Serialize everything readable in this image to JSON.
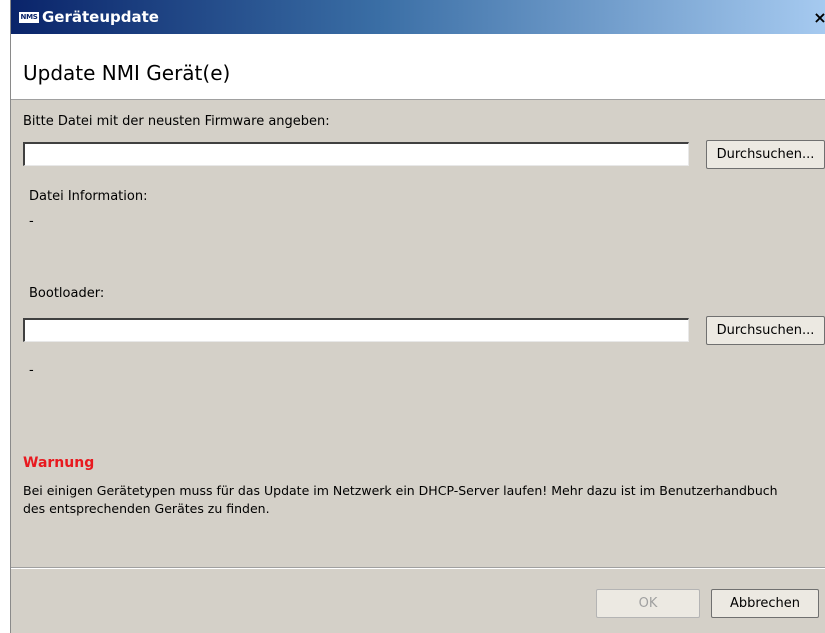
{
  "window": {
    "logo_text": "NMS",
    "title": "Geräteupdate",
    "close_glyph": "×"
  },
  "header": {
    "title": "Update NMI Gerät(e)"
  },
  "firmware": {
    "label": "Bitte Datei mit der neusten Firmware angeben:",
    "value": "",
    "browse_label": "Durchsuchen...",
    "info_label": "Datei Information:",
    "info_value": "-"
  },
  "bootloader": {
    "label": "Bootloader:",
    "value": "",
    "browse_label": "Durchsuchen...",
    "info_value": "-"
  },
  "warning": {
    "title": "Warnung",
    "text": "Bei einigen Gerätetypen muss für das Update im Netzwerk ein DHCP-Server laufen! Mehr dazu ist im Benutzerhandbuch des entsprechenden Gerätes zu finden.",
    "color": "#e8191f"
  },
  "footer": {
    "ok_label": "OK",
    "ok_enabled": false,
    "cancel_label": "Abbrechen"
  }
}
